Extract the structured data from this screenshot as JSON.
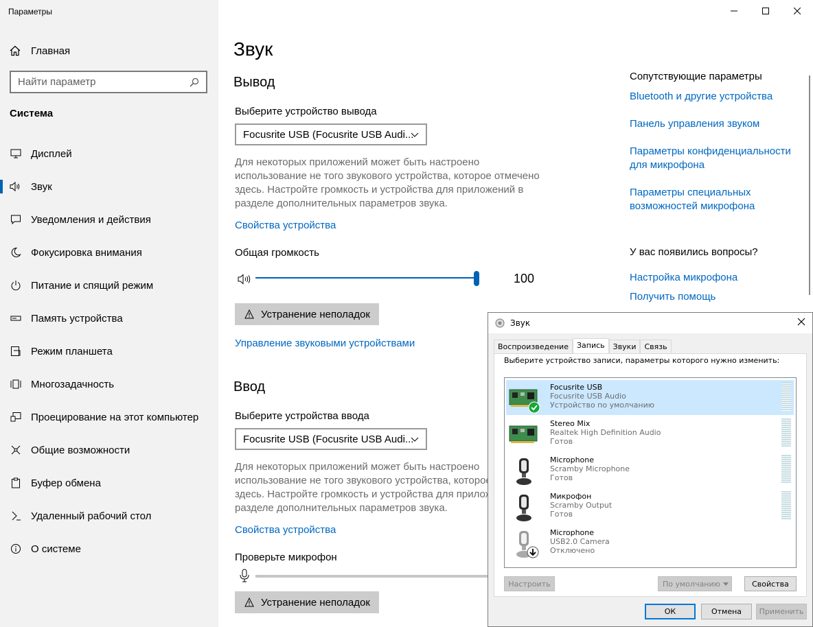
{
  "window": {
    "title": "Параметры"
  },
  "sidebar": {
    "home": "Главная",
    "search_placeholder": "Найти параметр",
    "section": "Система",
    "items": [
      {
        "label": "Дисплей",
        "icon": "display-icon"
      },
      {
        "label": "Звук",
        "icon": "speaker-icon",
        "active": true
      },
      {
        "label": "Уведомления и действия",
        "icon": "notifications-icon"
      },
      {
        "label": "Фокусировка внимания",
        "icon": "moon-icon"
      },
      {
        "label": "Питание и спящий режим",
        "icon": "power-icon"
      },
      {
        "label": "Память устройства",
        "icon": "storage-icon"
      },
      {
        "label": "Режим планшета",
        "icon": "tablet-icon"
      },
      {
        "label": "Многозадачность",
        "icon": "multitasking-icon"
      },
      {
        "label": "Проецирование на этот компьютер",
        "icon": "project-icon"
      },
      {
        "label": "Общие возможности",
        "icon": "shared-icon"
      },
      {
        "label": "Буфер обмена",
        "icon": "clipboard-icon"
      },
      {
        "label": "Удаленный рабочий стол",
        "icon": "remote-desktop-icon"
      },
      {
        "label": "О системе",
        "icon": "info-icon"
      }
    ]
  },
  "main": {
    "title": "Звук",
    "output": {
      "heading": "Вывод",
      "select_label": "Выберите устройство вывода",
      "device": "Focusrite USB (Focusrite USB Audi...",
      "desc": "Для некоторых приложений может быть настроено использование не того звукового устройства, которое отмечено здесь. Настройте громкость и устройства для приложений в разделе дополнительных параметров звука.",
      "device_props": "Свойства устройства",
      "volume_label": "Общая громкость",
      "volume": 100,
      "troubleshoot": "Устранение неполадок",
      "manage": "Управление звуковыми устройствами"
    },
    "input": {
      "heading": "Ввод",
      "select_label": "Выберите устройства ввода",
      "device": "Focusrite USB (Focusrite USB Audi...",
      "desc": "Для некоторых приложений может быть настроено использование не того звукового устройства, которое отмечено здесь. Настройте громкость и устройства для приложений в разделе дополнительных параметров звука.",
      "device_props": "Свойства устройства",
      "mic_label": "Проверьте микрофон",
      "troubleshoot": "Устранение неполадок"
    }
  },
  "related": {
    "title": "Сопутствующие параметры",
    "links": [
      "Bluetooth и другие устройства",
      "Панель управления звуком",
      "Параметры конфиденциальности для микрофона",
      "Параметры специальных возможностей микрофона"
    ],
    "questions_title": "У вас появились вопросы?",
    "question_links": [
      "Настройка микрофона",
      "Получить помощь"
    ]
  },
  "dialog": {
    "title": "Звук",
    "tabs": [
      "Воспроизведение",
      "Запись",
      "Звуки",
      "Связь"
    ],
    "active_tab": 1,
    "hint": "Выберите устройство записи, параметры которого нужно изменить:",
    "devices": [
      {
        "name": "Focusrite USB",
        "sub": "Focusrite USB Audio",
        "status": "Устройство по умолчанию",
        "type": "card",
        "badge": "check",
        "selected": true
      },
      {
        "name": "Stereo Mix",
        "sub": "Realtek High Definition Audio",
        "status": "Готов",
        "type": "card",
        "badge": "",
        "selected": false
      },
      {
        "name": "Microphone",
        "sub": "Scramby Microphone",
        "status": "Готов",
        "type": "mic",
        "badge": "",
        "selected": false
      },
      {
        "name": "Микрофон",
        "sub": "Scramby Output",
        "status": "Готов",
        "type": "mic",
        "badge": "",
        "selected": false
      },
      {
        "name": "Microphone",
        "sub": "USB2.0 Camera",
        "status": "Отключено",
        "type": "mic-disabled",
        "badge": "down",
        "selected": false
      }
    ],
    "configure": "Настроить",
    "set_default": "По умолчанию",
    "properties": "Свойства",
    "ok": "ОК",
    "cancel": "Отмена",
    "apply": "Применить"
  }
}
